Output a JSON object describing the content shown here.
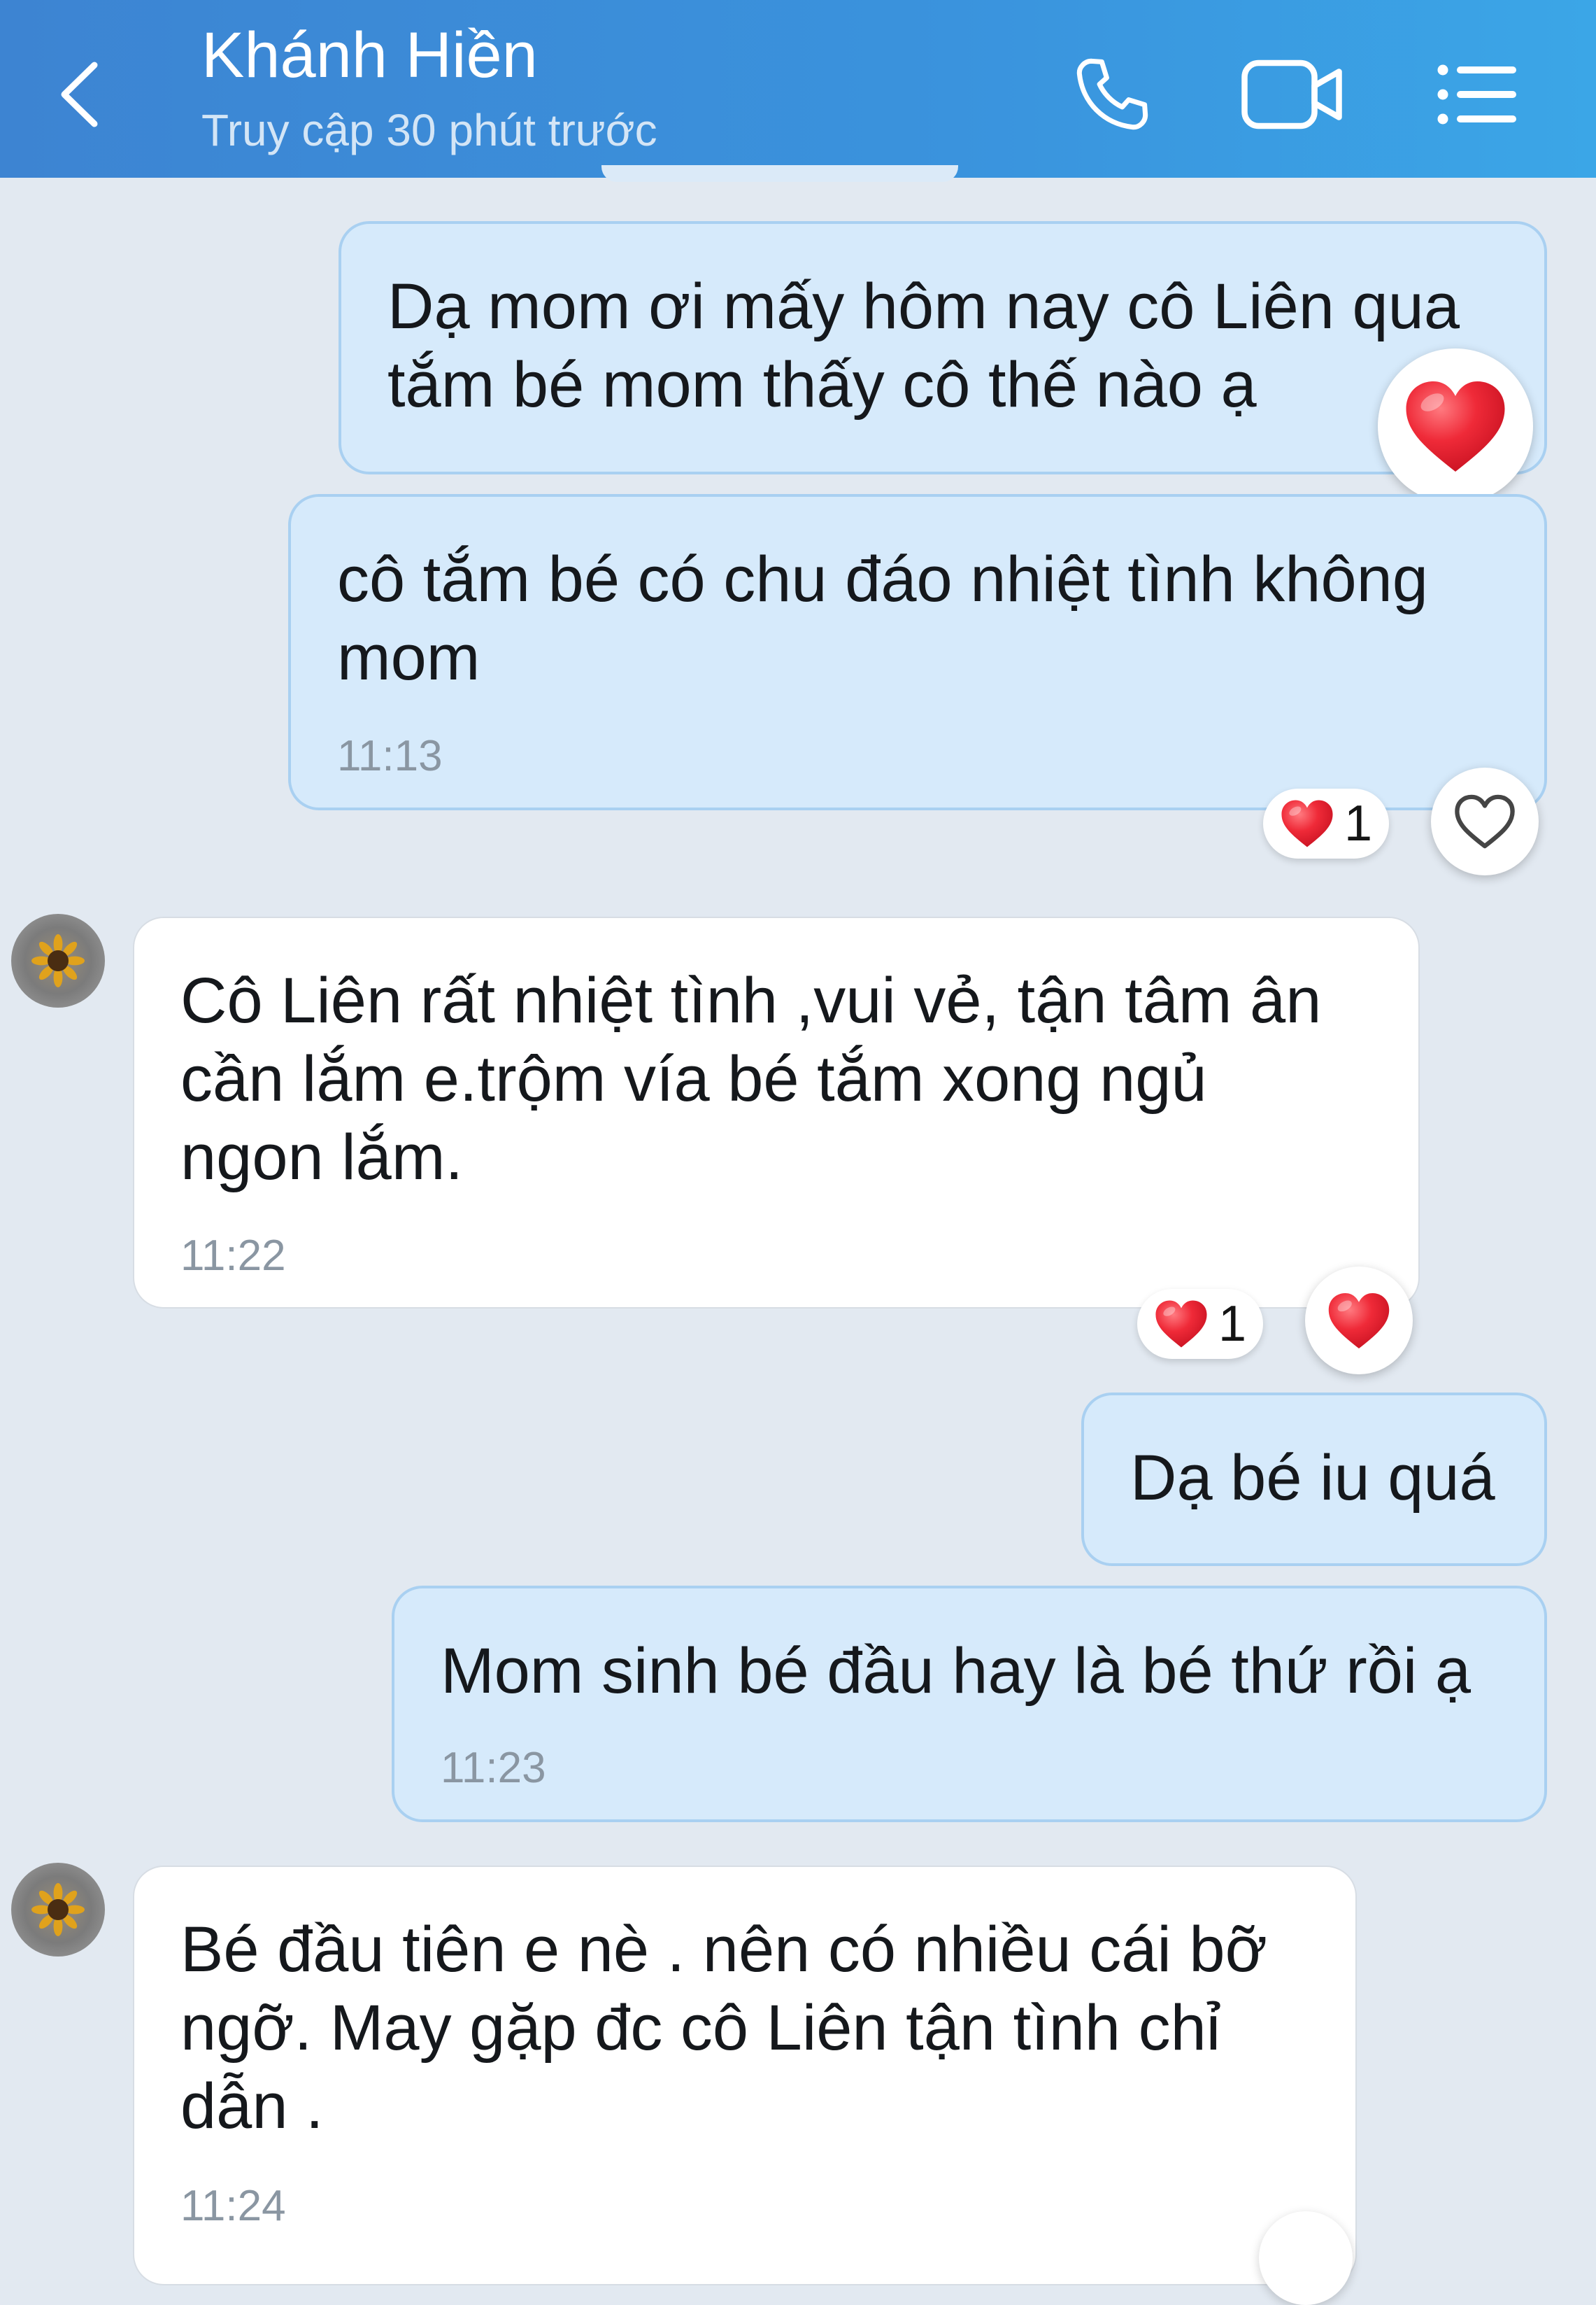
{
  "header": {
    "back_icon": "chevron-left-icon",
    "contact_name": "Khánh Hiền",
    "status": "Truy cập 30 phút trước",
    "call_icon": "phone-icon",
    "video_icon": "video-camera-icon",
    "menu_icon": "list-menu-icon"
  },
  "messages": [
    {
      "side": "sent",
      "text": "Dạ mom ơi mấy hôm nay cô Liên qua\ntắm bé mom thấy cô thế nào ạ",
      "reaction": "heart"
    },
    {
      "side": "sent",
      "text": "cô tắm bé có chu đáo nhiệt tình không\nmom",
      "time": "11:13",
      "reaction_count": "1"
    },
    {
      "side": "received",
      "text": "Cô Liên rất nhiệt tình ,vui vẻ, tận tâm ân\ncần lắm e.trộm vía bé tắm xong ngủ\nngon lắm.",
      "time": "11:22",
      "reaction_count": "1"
    },
    {
      "side": "sent",
      "text": "Dạ bé iu quá"
    },
    {
      "side": "sent",
      "text": "Mom sinh bé đầu hay là bé thứ rồi ạ",
      "time": "11:23"
    },
    {
      "side": "received",
      "text": "Bé đầu tiên e nè . nên có nhiều cái bỡ\nngỡ. May gặp đc cô Liên tận tình chỉ\ndẫn .",
      "time": "11:24"
    }
  ],
  "colors": {
    "header_gradient": [
      "#3d84d2",
      "#3ba6e7"
    ],
    "background": "#e2e9f1",
    "sent_bubble": "#d6eafb",
    "received_bubble": "#ffffff",
    "heart": "#e8202f"
  }
}
